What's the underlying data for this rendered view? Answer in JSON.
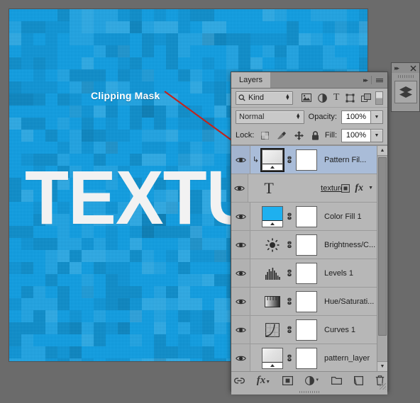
{
  "annotation": {
    "label": "Clipping Mask",
    "arrow_color": "#c0241d"
  },
  "canvas": {
    "text": "TEXTU",
    "base_color": "#0c9ee4",
    "text_color": "#f2f2f2"
  },
  "dock": {
    "expand_icon": "double-chevron-right-icon",
    "close_icon": "close-icon",
    "panel_icon": "layers-stack-icon"
  },
  "panel": {
    "tab_label": "Layers",
    "collapse_icon": "double-chevron-right-icon",
    "menu_icon": "panel-menu-icon",
    "filter": {
      "search_icon": "search-icon",
      "kind_label": "Kind",
      "icons": [
        "pixel-layer-filter-icon",
        "adjustment-layer-filter-icon",
        "type-layer-filter-icon",
        "shape-layer-filter-icon",
        "smart-object-filter-icon"
      ],
      "toggle_name": "filter-toggle-switch"
    },
    "blend": {
      "mode": "Normal",
      "opacity_label": "Opacity:",
      "opacity_value": "100%"
    },
    "lock": {
      "label": "Lock:",
      "icons": [
        "lock-transparent-pixels-icon",
        "lock-image-pixels-icon",
        "lock-position-icon",
        "lock-all-icon"
      ],
      "fill_label": "Fill:",
      "fill_value": "100%"
    },
    "layers": [
      {
        "name": "Pattern Fil...",
        "selected": true,
        "clipped": true,
        "visible": true,
        "thumb_type": "pattern-fill",
        "thumb_color": "#e8e8e8",
        "has_mask": true,
        "has_link": true
      },
      {
        "name": "texture",
        "selected": false,
        "clipped": false,
        "visible": true,
        "thumb_type": "type",
        "has_mask": false,
        "has_link": false,
        "right_icons": [
          "layer-mask-badge-icon",
          "fx-icon",
          "expand-fx-chevron-icon"
        ]
      },
      {
        "name": "Color Fill 1",
        "selected": false,
        "clipped": false,
        "visible": true,
        "thumb_type": "solid-fill",
        "thumb_color": "#1eb0ef",
        "has_mask": true,
        "has_link": true
      },
      {
        "name": "Brightness/C...",
        "selected": false,
        "clipped": false,
        "visible": true,
        "thumb_type": "adjustment-brightness",
        "has_mask": true,
        "has_link": true
      },
      {
        "name": "Levels 1",
        "selected": false,
        "clipped": false,
        "visible": true,
        "thumb_type": "adjustment-levels",
        "has_mask": true,
        "has_link": true
      },
      {
        "name": "Hue/Saturati...",
        "selected": false,
        "clipped": false,
        "visible": true,
        "thumb_type": "adjustment-huesat",
        "has_mask": true,
        "has_link": true
      },
      {
        "name": "Curves 1",
        "selected": false,
        "clipped": false,
        "visible": true,
        "thumb_type": "adjustment-curves",
        "has_mask": true,
        "has_link": true
      },
      {
        "name": "pattern_layer",
        "selected": false,
        "clipped": false,
        "visible": true,
        "thumb_type": "pattern-fill",
        "thumb_color": "#e2e2e2",
        "has_mask": true,
        "has_link": true
      }
    ],
    "bottom_toolbar": [
      "link-layers-icon",
      "layer-style-fx-icon",
      "add-layer-mask-icon",
      "new-adjustment-layer-icon",
      "new-group-icon",
      "new-layer-icon",
      "delete-layer-icon"
    ]
  }
}
